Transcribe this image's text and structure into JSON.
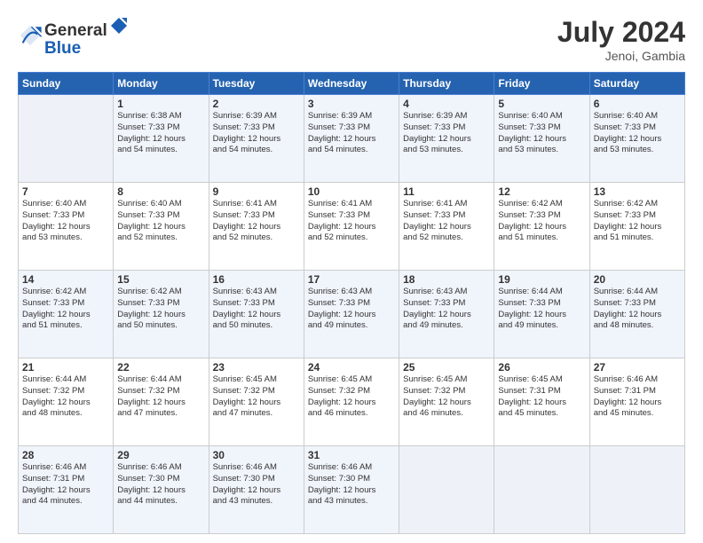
{
  "header": {
    "logo_line1": "General",
    "logo_line2": "Blue",
    "month_year": "July 2024",
    "location": "Jenoi, Gambia"
  },
  "weekdays": [
    "Sunday",
    "Monday",
    "Tuesday",
    "Wednesday",
    "Thursday",
    "Friday",
    "Saturday"
  ],
  "weeks": [
    [
      {
        "day": "",
        "sunrise": "",
        "sunset": "",
        "daylight": ""
      },
      {
        "day": "1",
        "sunrise": "Sunrise: 6:38 AM",
        "sunset": "Sunset: 7:33 PM",
        "daylight": "Daylight: 12 hours and 54 minutes."
      },
      {
        "day": "2",
        "sunrise": "Sunrise: 6:39 AM",
        "sunset": "Sunset: 7:33 PM",
        "daylight": "Daylight: 12 hours and 54 minutes."
      },
      {
        "day": "3",
        "sunrise": "Sunrise: 6:39 AM",
        "sunset": "Sunset: 7:33 PM",
        "daylight": "Daylight: 12 hours and 54 minutes."
      },
      {
        "day": "4",
        "sunrise": "Sunrise: 6:39 AM",
        "sunset": "Sunset: 7:33 PM",
        "daylight": "Daylight: 12 hours and 53 minutes."
      },
      {
        "day": "5",
        "sunrise": "Sunrise: 6:40 AM",
        "sunset": "Sunset: 7:33 PM",
        "daylight": "Daylight: 12 hours and 53 minutes."
      },
      {
        "day": "6",
        "sunrise": "Sunrise: 6:40 AM",
        "sunset": "Sunset: 7:33 PM",
        "daylight": "Daylight: 12 hours and 53 minutes."
      }
    ],
    [
      {
        "day": "7",
        "sunrise": "Sunrise: 6:40 AM",
        "sunset": "Sunset: 7:33 PM",
        "daylight": "Daylight: 12 hours and 53 minutes."
      },
      {
        "day": "8",
        "sunrise": "Sunrise: 6:40 AM",
        "sunset": "Sunset: 7:33 PM",
        "daylight": "Daylight: 12 hours and 52 minutes."
      },
      {
        "day": "9",
        "sunrise": "Sunrise: 6:41 AM",
        "sunset": "Sunset: 7:33 PM",
        "daylight": "Daylight: 12 hours and 52 minutes."
      },
      {
        "day": "10",
        "sunrise": "Sunrise: 6:41 AM",
        "sunset": "Sunset: 7:33 PM",
        "daylight": "Daylight: 12 hours and 52 minutes."
      },
      {
        "day": "11",
        "sunrise": "Sunrise: 6:41 AM",
        "sunset": "Sunset: 7:33 PM",
        "daylight": "Daylight: 12 hours and 52 minutes."
      },
      {
        "day": "12",
        "sunrise": "Sunrise: 6:42 AM",
        "sunset": "Sunset: 7:33 PM",
        "daylight": "Daylight: 12 hours and 51 minutes."
      },
      {
        "day": "13",
        "sunrise": "Sunrise: 6:42 AM",
        "sunset": "Sunset: 7:33 PM",
        "daylight": "Daylight: 12 hours and 51 minutes."
      }
    ],
    [
      {
        "day": "14",
        "sunrise": "Sunrise: 6:42 AM",
        "sunset": "Sunset: 7:33 PM",
        "daylight": "Daylight: 12 hours and 51 minutes."
      },
      {
        "day": "15",
        "sunrise": "Sunrise: 6:42 AM",
        "sunset": "Sunset: 7:33 PM",
        "daylight": "Daylight: 12 hours and 50 minutes."
      },
      {
        "day": "16",
        "sunrise": "Sunrise: 6:43 AM",
        "sunset": "Sunset: 7:33 PM",
        "daylight": "Daylight: 12 hours and 50 minutes."
      },
      {
        "day": "17",
        "sunrise": "Sunrise: 6:43 AM",
        "sunset": "Sunset: 7:33 PM",
        "daylight": "Daylight: 12 hours and 49 minutes."
      },
      {
        "day": "18",
        "sunrise": "Sunrise: 6:43 AM",
        "sunset": "Sunset: 7:33 PM",
        "daylight": "Daylight: 12 hours and 49 minutes."
      },
      {
        "day": "19",
        "sunrise": "Sunrise: 6:44 AM",
        "sunset": "Sunset: 7:33 PM",
        "daylight": "Daylight: 12 hours and 49 minutes."
      },
      {
        "day": "20",
        "sunrise": "Sunrise: 6:44 AM",
        "sunset": "Sunset: 7:33 PM",
        "daylight": "Daylight: 12 hours and 48 minutes."
      }
    ],
    [
      {
        "day": "21",
        "sunrise": "Sunrise: 6:44 AM",
        "sunset": "Sunset: 7:32 PM",
        "daylight": "Daylight: 12 hours and 48 minutes."
      },
      {
        "day": "22",
        "sunrise": "Sunrise: 6:44 AM",
        "sunset": "Sunset: 7:32 PM",
        "daylight": "Daylight: 12 hours and 47 minutes."
      },
      {
        "day": "23",
        "sunrise": "Sunrise: 6:45 AM",
        "sunset": "Sunset: 7:32 PM",
        "daylight": "Daylight: 12 hours and 47 minutes."
      },
      {
        "day": "24",
        "sunrise": "Sunrise: 6:45 AM",
        "sunset": "Sunset: 7:32 PM",
        "daylight": "Daylight: 12 hours and 46 minutes."
      },
      {
        "day": "25",
        "sunrise": "Sunrise: 6:45 AM",
        "sunset": "Sunset: 7:32 PM",
        "daylight": "Daylight: 12 hours and 46 minutes."
      },
      {
        "day": "26",
        "sunrise": "Sunrise: 6:45 AM",
        "sunset": "Sunset: 7:31 PM",
        "daylight": "Daylight: 12 hours and 45 minutes."
      },
      {
        "day": "27",
        "sunrise": "Sunrise: 6:46 AM",
        "sunset": "Sunset: 7:31 PM",
        "daylight": "Daylight: 12 hours and 45 minutes."
      }
    ],
    [
      {
        "day": "28",
        "sunrise": "Sunrise: 6:46 AM",
        "sunset": "Sunset: 7:31 PM",
        "daylight": "Daylight: 12 hours and 44 minutes."
      },
      {
        "day": "29",
        "sunrise": "Sunrise: 6:46 AM",
        "sunset": "Sunset: 7:30 PM",
        "daylight": "Daylight: 12 hours and 44 minutes."
      },
      {
        "day": "30",
        "sunrise": "Sunrise: 6:46 AM",
        "sunset": "Sunset: 7:30 PM",
        "daylight": "Daylight: 12 hours and 43 minutes."
      },
      {
        "day": "31",
        "sunrise": "Sunrise: 6:46 AM",
        "sunset": "Sunset: 7:30 PM",
        "daylight": "Daylight: 12 hours and 43 minutes."
      },
      {
        "day": "",
        "sunrise": "",
        "sunset": "",
        "daylight": ""
      },
      {
        "day": "",
        "sunrise": "",
        "sunset": "",
        "daylight": ""
      },
      {
        "day": "",
        "sunrise": "",
        "sunset": "",
        "daylight": ""
      }
    ]
  ]
}
